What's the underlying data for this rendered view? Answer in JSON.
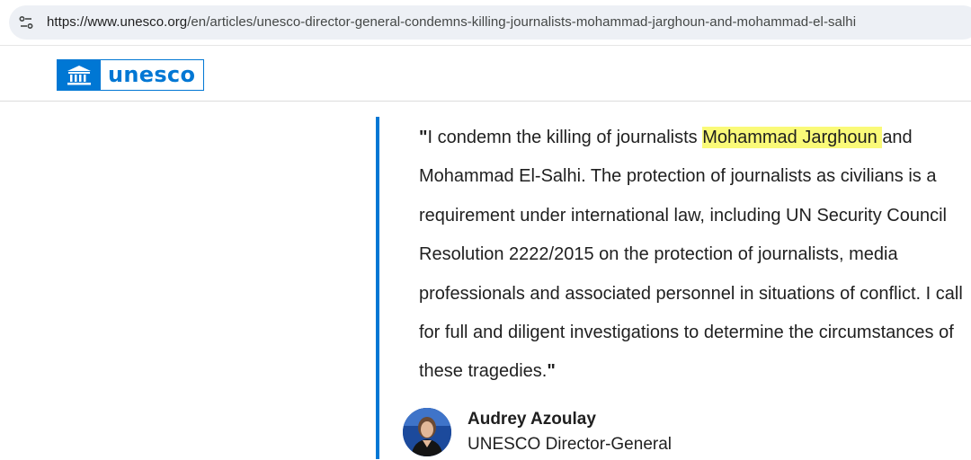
{
  "browser": {
    "url_host": "https://www.unesco.org",
    "url_path": "/en/articles/unesco-director-general-condemns-killing-journalists-mohammad-jarghoun-and-mohammad-el-salhi"
  },
  "header": {
    "logo_text": "unesco"
  },
  "quote": {
    "open_mark": "\"",
    "text_before": "I condemn the killing of journalists ",
    "highlight": "Mohammad Jarghoun ",
    "text_after": "and Mohammad El-Salhi. The protection of journalists as civilians is a requirement under international law, including UN Security Council Resolution 2222/2015 on the protection of journalists, media professionals and associated personnel in situations of conflict. I call for full and diligent investigations to determine the circumstances of these tragedies.",
    "close_mark": "\"",
    "author_name": "Audrey Azoulay",
    "author_title": "UNESCO Director-General"
  },
  "colors": {
    "brand": "#0077d4",
    "highlight": "#fafa78",
    "address_pill": "#edf0f5"
  },
  "icons": {
    "site_info": "tune-icon",
    "logo_mark": "temple-icon"
  }
}
